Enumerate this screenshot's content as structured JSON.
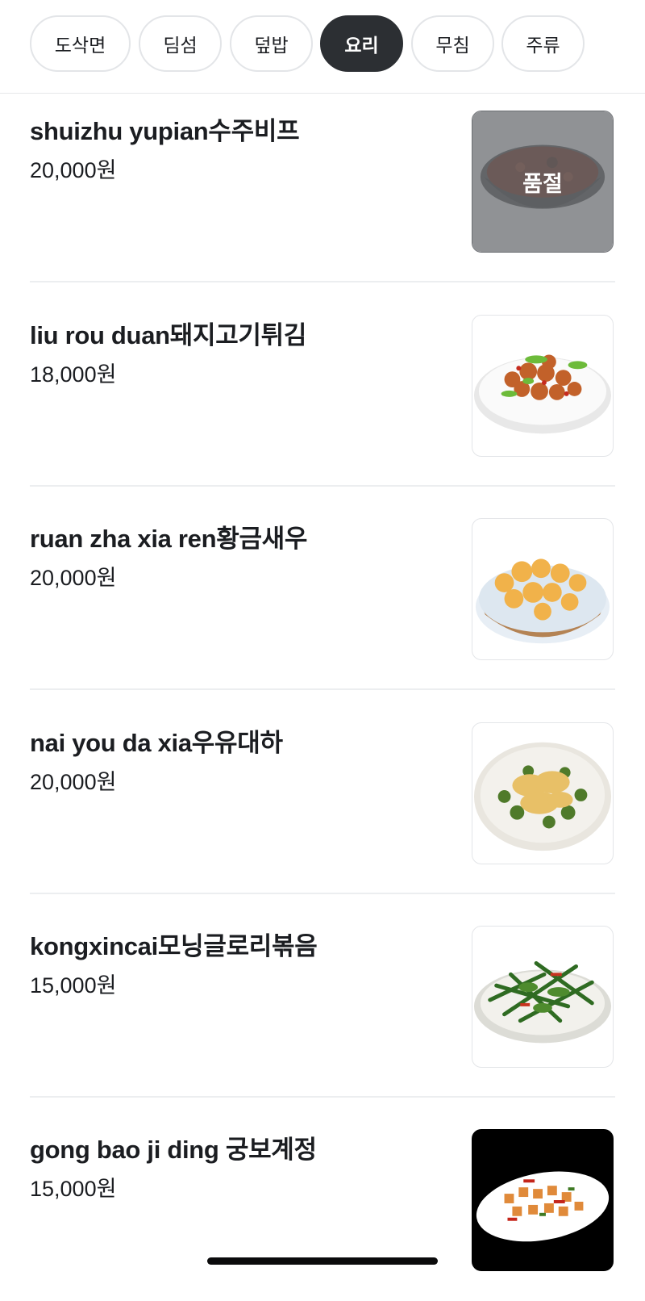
{
  "categories": {
    "tabs": [
      {
        "label": "도삭면"
      },
      {
        "label": "딤섬"
      },
      {
        "label": "덮밥"
      },
      {
        "label": "요리",
        "active": true
      },
      {
        "label": "무침"
      },
      {
        "label": "주류"
      }
    ]
  },
  "menu": {
    "items": [
      {
        "name": "shuizhu yupian수주비프",
        "price": "20,000원",
        "badge": "품절",
        "sold_out": true
      },
      {
        "name": "liu rou duan돼지고기튀김",
        "price": "18,000원"
      },
      {
        "name": "ruan zha xia ren황금새우",
        "price": "20,000원"
      },
      {
        "name": "nai you da xia우유대하",
        "price": "20,000원"
      },
      {
        "name": "kongxincai모닝글로리볶음",
        "price": "15,000원"
      },
      {
        "name": "gong bao ji ding 궁보계정",
        "price": "15,000원"
      }
    ]
  },
  "colors": {
    "active_tab": "#2c2f33",
    "soldout_overlay": "#6b6e72",
    "divider": "#eceef0"
  }
}
